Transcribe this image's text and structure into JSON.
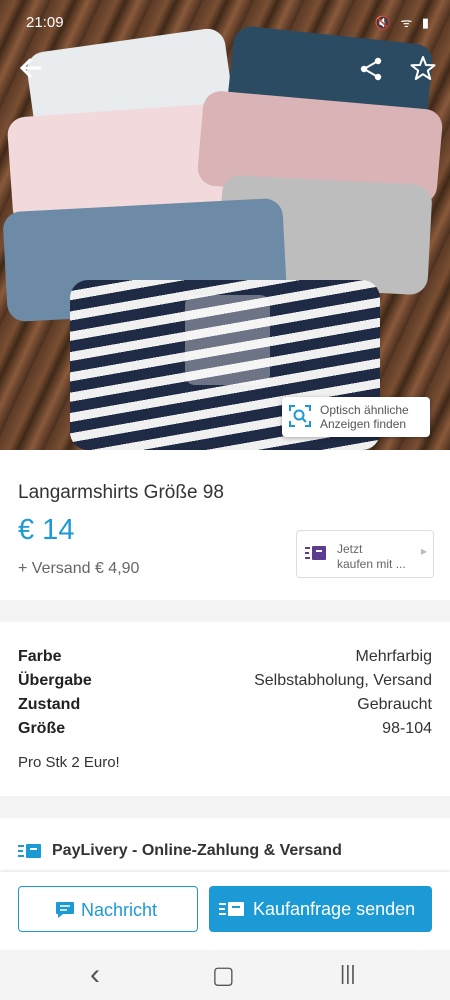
{
  "status_bar": {
    "time": "21:09",
    "icons": "🔇 ᯤ ▮"
  },
  "listing": {
    "title": "Langarmshirts Größe 98",
    "price": "€ 14",
    "shipping": "+ Versand € 4,90",
    "visual_search_label_1": "Optisch ähnliche",
    "visual_search_label_2": "Anzeigen finden",
    "buy_now_label_1": "Jetzt",
    "buy_now_label_2": "kaufen mit ..."
  },
  "attributes": [
    {
      "key": "Farbe",
      "value": "Mehrfarbig"
    },
    {
      "key": "Übergabe",
      "value": "Selbstabholung, Versand"
    },
    {
      "key": "Zustand",
      "value": "Gebraucht"
    },
    {
      "key": "Größe",
      "value": "98-104"
    }
  ],
  "description": "Pro Stk 2 Euro!",
  "paylivery": {
    "label": "PayLivery - Online-Zahlung & Versand"
  },
  "actions": {
    "message_label": "Nachricht",
    "buy_request_label": "Kaufanfrage senden"
  },
  "navigation": {
    "back": "‹",
    "home": "▢",
    "recents": "|||"
  },
  "colors": {
    "accent": "#1b9ad6",
    "buy_now_icon": "#5b3c8f"
  },
  "icons": [
    "back-arrow-icon",
    "share-icon",
    "star-icon",
    "visual-search-icon",
    "paylivery-icon",
    "chat-icon"
  ]
}
